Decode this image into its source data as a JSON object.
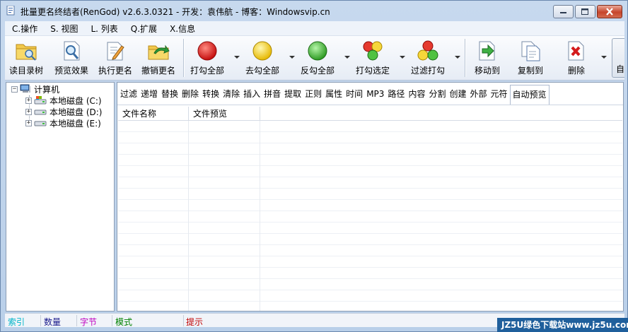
{
  "window": {
    "title": "批量更名终结者(RenGod) v2.6.3.0321 - 开发：袁伟航 - 博客：Windowsvip.cn"
  },
  "menu": [
    {
      "label": "C.操作"
    },
    {
      "label": "S. 视图"
    },
    {
      "label": "L. 列表"
    },
    {
      "label": "Q.扩展"
    },
    {
      "label": "X.信息"
    }
  ],
  "toolbar": {
    "read_dir": "读目录树",
    "preview": "预览效果",
    "execute": "执行更名",
    "undo": "撤销更名",
    "check_all": "打勾全部",
    "uncheck_all": "去勾全部",
    "invert": "反勾全部",
    "check_selected": "打勾选定",
    "filter_check": "过滤打勾",
    "move_to": "移动到",
    "copy_to": "复制到",
    "delete": "删除",
    "overflow": "自"
  },
  "tree": {
    "root": "计算机",
    "drives": [
      {
        "label": "本地磁盘 (C:)"
      },
      {
        "label": "本地磁盘 (D:)"
      },
      {
        "label": "本地磁盘 (E:)"
      }
    ]
  },
  "tabs": [
    "过滤",
    "递增",
    "替换",
    "删除",
    "转换",
    "清除",
    "插入",
    "拼音",
    "提取",
    "正则",
    "属性",
    "时间",
    "MP3",
    "路径",
    "内容",
    "分割",
    "创建",
    "外部",
    "元符",
    "自动预览"
  ],
  "active_tab": "自动预览",
  "grid": {
    "columns": [
      "文件名称",
      "文件预览"
    ]
  },
  "status": {
    "index": "索引",
    "count": "数量",
    "bytes": "字节",
    "mode": "模式",
    "hint": "提示"
  },
  "colors": {
    "status_index": "#00b4c8",
    "status_count": "#1a1a8c",
    "status_bytes": "#c000c0",
    "status_mode": "#008000",
    "status_hint": "#c00000"
  },
  "watermark": "JZ5U绿色下载站www.jz5u.com"
}
